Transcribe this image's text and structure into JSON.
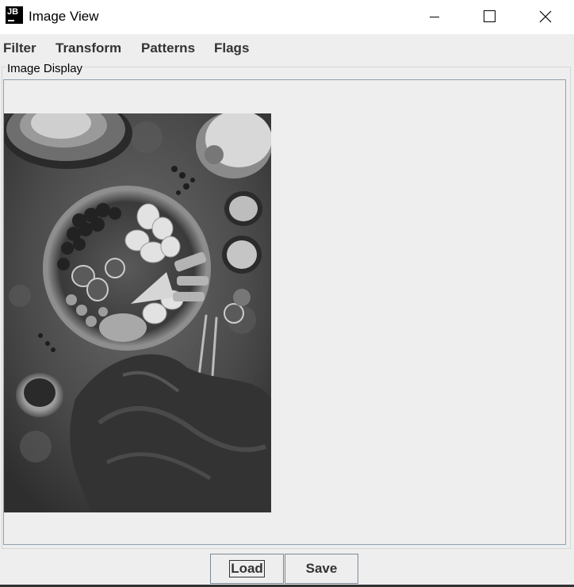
{
  "window": {
    "icon_text": "JB",
    "title": "Image View",
    "controls": [
      "minimize-icon",
      "maximize-icon",
      "close-icon"
    ]
  },
  "menu": {
    "items": [
      {
        "label": "Filter"
      },
      {
        "label": "Transform"
      },
      {
        "label": "Patterns"
      },
      {
        "label": "Flags"
      }
    ]
  },
  "panel": {
    "title": "Image Display",
    "image_description": "grayscale photo of a fruit platter on a table"
  },
  "buttons": {
    "load_label": "Load",
    "save_label": "Save"
  },
  "colors": {
    "window_bg": "#eeeeee",
    "titlebar_bg": "#ffffff",
    "display_border": "#8fa3b3"
  }
}
